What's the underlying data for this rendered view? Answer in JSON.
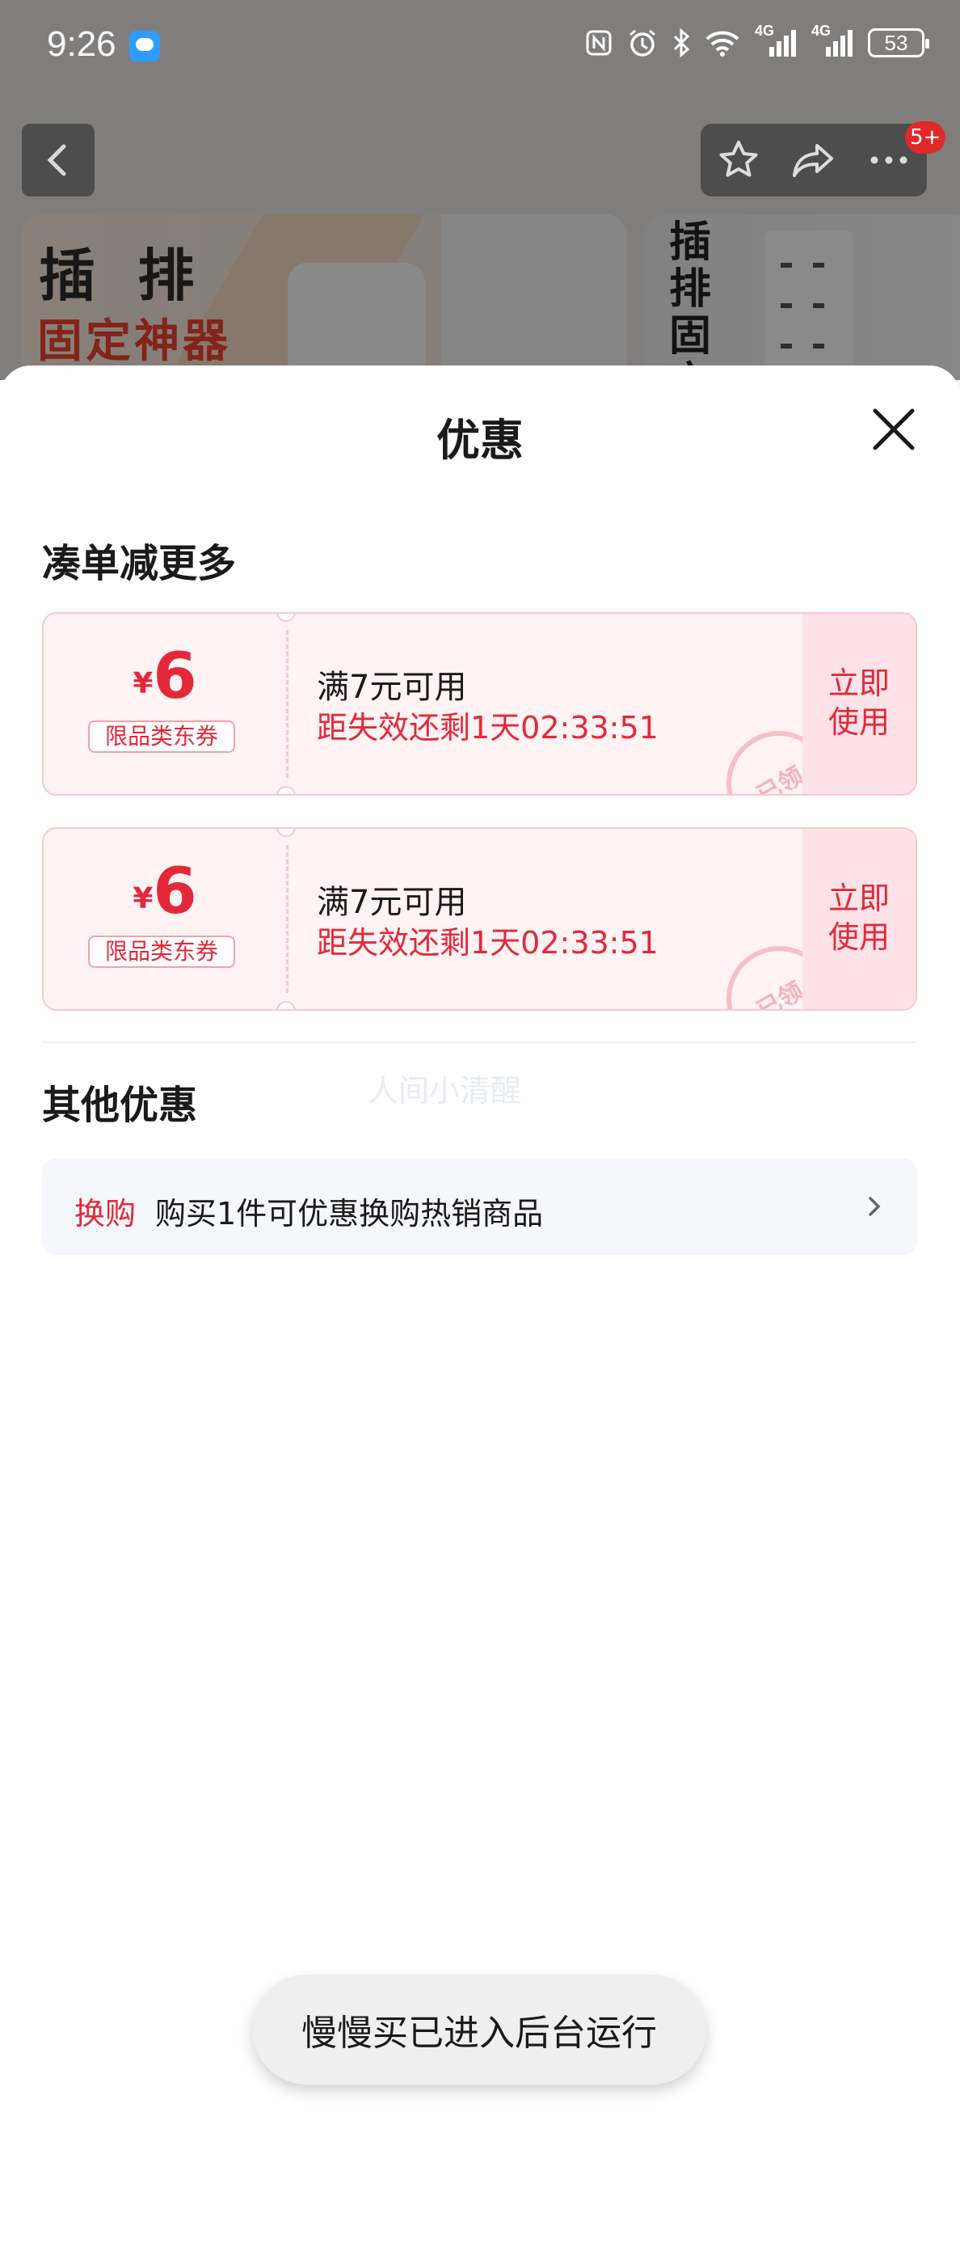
{
  "status_bar": {
    "time": "9:26",
    "battery": "53",
    "network_1": "4G",
    "network_2": "4G"
  },
  "nav": {
    "badge": "5+"
  },
  "background": {
    "image1_title": "插 排",
    "image1_subtitle": "固定神器",
    "image2_title": "插排固定"
  },
  "sheet": {
    "title": "优惠",
    "section_bundle": "凑单减更多",
    "coupons": [
      {
        "currency": "¥",
        "amount": "6",
        "tag": "限品类东券",
        "condition": "满7元可用",
        "expire": "距失效还剩1天02:33:51",
        "action": "立即使用",
        "stamp": "已领"
      },
      {
        "currency": "¥",
        "amount": "6",
        "tag": "限品类东券",
        "condition": "满7元可用",
        "expire": "距失效还剩1天02:33:51",
        "action": "立即使用",
        "stamp": "已领"
      }
    ],
    "section_other": "其他优惠",
    "watermark": "人间小清醒",
    "other_offer": {
      "label": "换购",
      "text": "购买1件可优惠换购热销商品"
    }
  },
  "toast": "慢慢买已进入后台运行",
  "colors": {
    "accent": "#e4283a",
    "coupon_bg": "#fff3f4",
    "coupon_border": "#f6c9cf"
  }
}
